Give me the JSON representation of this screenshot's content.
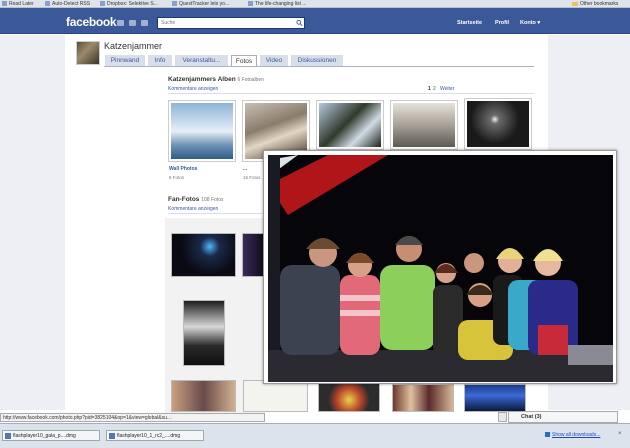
{
  "bookmarks": [
    "Read Later",
    "Auto-Detect RSS",
    "Dropbox: Selektive S...",
    "QuestTracker lets yo...",
    "The life-changing list ...",
    "Other bookmarks"
  ],
  "header": {
    "logo": "facebook",
    "search_placeholder": "Suche",
    "nav": [
      "Startseite",
      "Profil",
      "Konto ▾"
    ]
  },
  "profile": {
    "name": "Katzenjammer",
    "tabs": [
      "Pinnwand",
      "Info",
      "Veranstaltu...",
      "Fotos",
      "Video",
      "Diskussionen"
    ],
    "active_tab": "Fotos"
  },
  "albums_section": {
    "title": "Katzenjammers Alben",
    "count": "6 Fotoalben",
    "comments_link": "Kommentare anzeigen",
    "pager_current": "1",
    "pager_next_num": "2",
    "pager_next": "Weiter",
    "albums": [
      {
        "name": "Wall Photos",
        "count": "8 Fotos"
      },
      {
        "name": "...",
        "count": "16 Fotos"
      }
    ]
  },
  "fan_section": {
    "title": "Fan-Fotos",
    "count": "108 Fotos",
    "comments_link": "Kommentare anzeigen"
  },
  "status_url": "http://www.facebook.com/photo.php?pid=3825104&op=1&view=global&su...",
  "chat_label": "Chat (3)",
  "downloads": [
    "flashplayer10_gala_p....dmg",
    "flashplayer10_1_rc2_....dmg"
  ],
  "downloads_show_all": "Show all downloads...",
  "downloads_close": "×"
}
